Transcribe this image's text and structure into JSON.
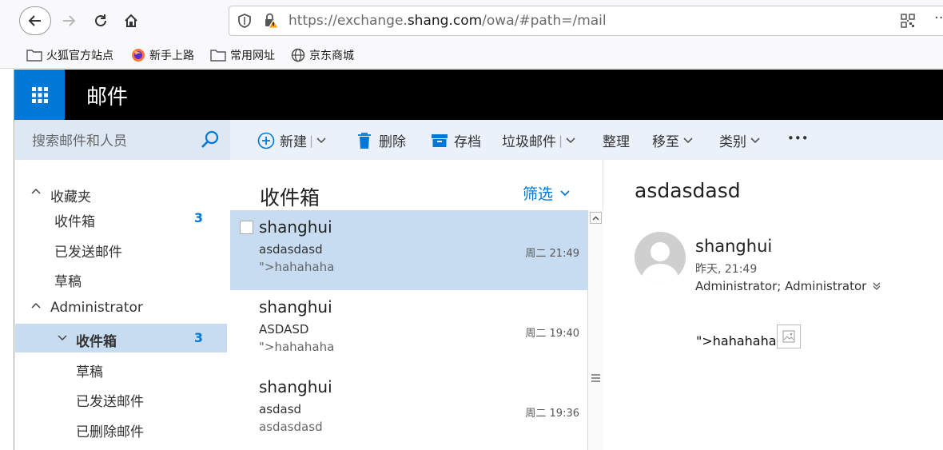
{
  "browser": {
    "url_prefix": "https://exchange.",
    "url_domain": "shang.com",
    "url_path": "/owa/#path=/mail",
    "more": "··"
  },
  "bookmarks": [
    {
      "label": "火狐官方站点",
      "icon": "folder-icon"
    },
    {
      "label": "新手上路",
      "icon": "firefox-icon"
    },
    {
      "label": "常用网址",
      "icon": "folder-icon"
    },
    {
      "label": "京东商城",
      "icon": "globe-icon"
    }
  ],
  "app": {
    "title": "邮件"
  },
  "search": {
    "placeholder": "搜索邮件和人员"
  },
  "commands": {
    "new": "新建",
    "delete": "删除",
    "archive": "存档",
    "junk": "垃圾邮件",
    "sweep": "整理",
    "move": "移至",
    "categorize": "类别",
    "more": "•••",
    "separator": "|"
  },
  "folders": {
    "favorites_label": "收藏夹",
    "favorites": [
      {
        "label": "收件箱",
        "count": "3"
      },
      {
        "label": "已发送邮件",
        "count": ""
      },
      {
        "label": "草稿",
        "count": ""
      }
    ],
    "account_label": "Administrator",
    "account": [
      {
        "label": "收件箱",
        "count": "3"
      },
      {
        "label": "草稿",
        "count": ""
      },
      {
        "label": "已发送邮件",
        "count": ""
      },
      {
        "label": "已删除邮件",
        "count": ""
      }
    ]
  },
  "message_list": {
    "heading": "收件箱",
    "filter": "筛选",
    "messages": [
      {
        "sender": "shanghui",
        "subject": "asdasdasd",
        "preview": "\">hahahaha",
        "time": "周二 21:49"
      },
      {
        "sender": "shanghui",
        "subject": "ASDASD",
        "preview": "\">hahahaha",
        "time": "周二 19:40"
      },
      {
        "sender": "shanghui",
        "subject": "asdasd",
        "preview": "asdasdasd",
        "time": "周二 19:36"
      }
    ]
  },
  "reading": {
    "subject": "asdasdasd",
    "sender": "shanghui",
    "date": "昨天, 21:49",
    "to": "Administrator; Administrator",
    "body": "\">hahahaha"
  },
  "colors": {
    "accent": "#0078d7",
    "selected": "#c7dcf0",
    "command_bar": "#eaf1fb"
  }
}
